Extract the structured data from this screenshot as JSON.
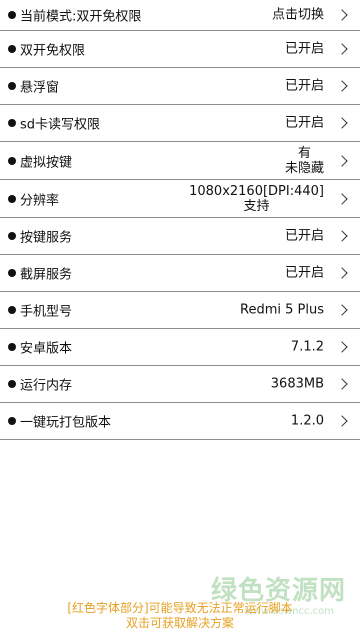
{
  "rows": [
    {
      "label": "当前模式:双开免权限",
      "value": [
        "点击切换"
      ]
    },
    {
      "label": "双开免权限",
      "value": [
        "已开启"
      ]
    },
    {
      "label": "悬浮窗",
      "value": [
        "已开启"
      ]
    },
    {
      "label": "sd卡读写权限",
      "value": [
        "已开启"
      ]
    },
    {
      "label": "虚拟按键",
      "value": [
        "有",
        "未隐藏"
      ]
    },
    {
      "label": "分辨率",
      "value": [
        "1080x2160[DPI:440]",
        "支持"
      ]
    },
    {
      "label": "按键服务",
      "value": [
        "已开启"
      ]
    },
    {
      "label": "截屏服务",
      "value": [
        "已开启"
      ]
    },
    {
      "label": "手机型号",
      "value": [
        "Redmi 5 Plus"
      ]
    },
    {
      "label": "安卓版本",
      "value": [
        "7.1.2"
      ]
    },
    {
      "label": "运行内存",
      "value": [
        "3683MB"
      ]
    },
    {
      "label": "一键玩打包版本",
      "value": [
        "1.2.0"
      ]
    }
  ],
  "footer": {
    "line1": "[红色字体部分]可能导致无法正常运行脚本",
    "line2": "双击可获取解决方案"
  },
  "watermark": {
    "title": "绿色资源网",
    "url": "www.downcc.com"
  },
  "colors": {
    "footer_text": "#e8a021",
    "divider": "#8f8f8f"
  }
}
